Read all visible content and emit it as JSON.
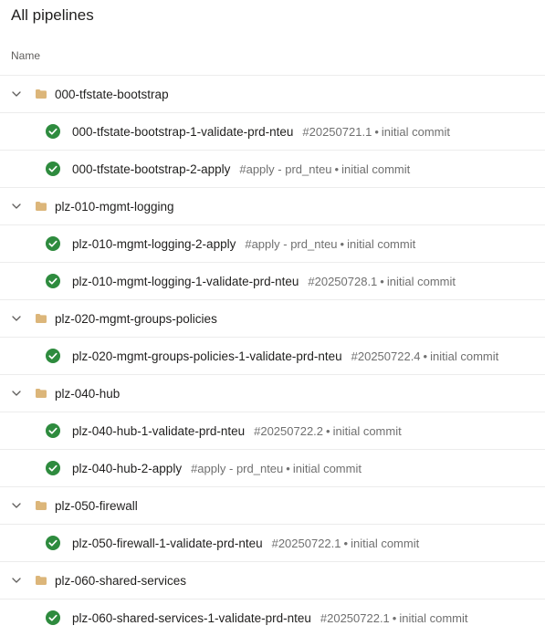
{
  "page": {
    "title": "All pipelines",
    "column_header": "Name"
  },
  "colors": {
    "success": "#2e8b3e",
    "folder": "#dcb67a",
    "chevron": "#605e5c"
  },
  "folders": [
    {
      "name": "000-tfstate-bootstrap",
      "expanded": true,
      "pipelines": [
        {
          "name": "000-tfstate-bootstrap-1-validate-prd-nteu",
          "run": "#20250721.1",
          "sep": "•",
          "message": "initial commit",
          "status": "success"
        },
        {
          "name": "000-tfstate-bootstrap-2-apply",
          "run": "#apply - prd_nteu",
          "sep": "•",
          "message": "initial commit",
          "status": "success"
        }
      ]
    },
    {
      "name": "plz-010-mgmt-logging",
      "expanded": true,
      "pipelines": [
        {
          "name": "plz-010-mgmt-logging-2-apply",
          "run": "#apply - prd_nteu",
          "sep": "•",
          "message": "initial commit",
          "status": "success"
        },
        {
          "name": "plz-010-mgmt-logging-1-validate-prd-nteu",
          "run": "#20250728.1",
          "sep": "•",
          "message": "initial commit",
          "status": "success"
        }
      ]
    },
    {
      "name": "plz-020-mgmt-groups-policies",
      "expanded": true,
      "pipelines": [
        {
          "name": "plz-020-mgmt-groups-policies-1-validate-prd-nteu",
          "run": "#20250722.4",
          "sep": "•",
          "message": "initial commit",
          "status": "success"
        }
      ]
    },
    {
      "name": "plz-040-hub",
      "expanded": true,
      "pipelines": [
        {
          "name": "plz-040-hub-1-validate-prd-nteu",
          "run": "#20250722.2",
          "sep": "•",
          "message": "initial commit",
          "status": "success"
        },
        {
          "name": "plz-040-hub-2-apply",
          "run": "#apply - prd_nteu",
          "sep": "•",
          "message": "initial commit",
          "status": "success"
        }
      ]
    },
    {
      "name": "plz-050-firewall",
      "expanded": true,
      "pipelines": [
        {
          "name": "plz-050-firewall-1-validate-prd-nteu",
          "run": "#20250722.1",
          "sep": "•",
          "message": "initial commit",
          "status": "success"
        }
      ]
    },
    {
      "name": "plz-060-shared-services",
      "expanded": true,
      "pipelines": [
        {
          "name": "plz-060-shared-services-1-validate-prd-nteu",
          "run": "#20250722.1",
          "sep": "•",
          "message": "initial commit",
          "status": "success"
        }
      ]
    }
  ]
}
